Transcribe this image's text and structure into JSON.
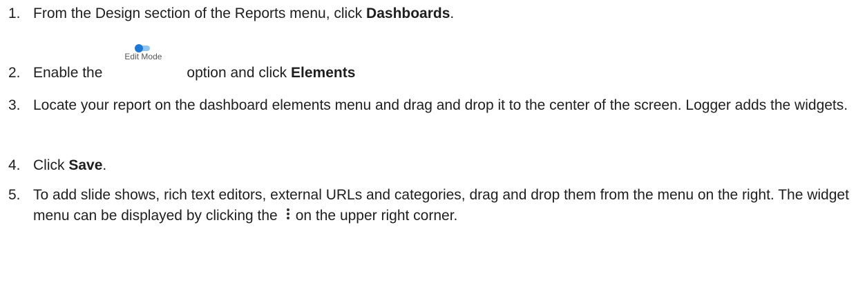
{
  "steps": [
    {
      "number": "1.",
      "before": "From the Design section of the Reports menu, click ",
      "bold": "Dashboards",
      "after": "."
    },
    {
      "number": "2.",
      "before": "Enable the",
      "inline_image_label": "Edit Mode",
      "middle": "option and click ",
      "bold": "Elements"
    },
    {
      "number": "3.",
      "text": "Locate your report on the dashboard elements menu and drag and drop it to the center of the screen. Logger adds the widgets."
    },
    {
      "number": "4.",
      "before": "Click ",
      "bold": "Save",
      "after": "."
    },
    {
      "number": "5.",
      "before": "To add slide shows, rich text editors, external URLs and categories, drag and drop them from the menu on the right. The widget menu can be displayed by clicking the",
      "after": "on the upper right corner."
    }
  ],
  "icons": {
    "toggle": "toggle-switch-icon",
    "kebab": "vertical-ellipsis-icon"
  },
  "colors": {
    "text": "#1e1e1e",
    "toggle_knob": "#1e78d6",
    "toggle_track": "#8ec5f2"
  }
}
